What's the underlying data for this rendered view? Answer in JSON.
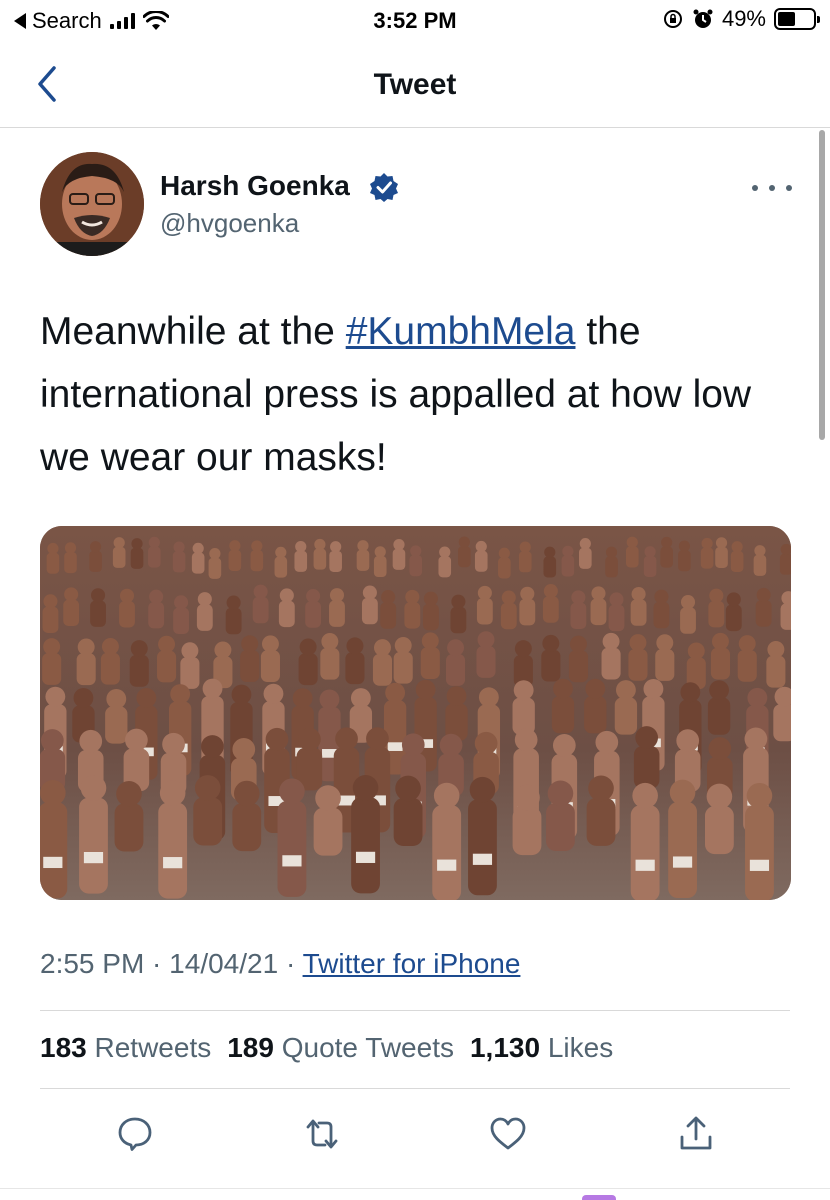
{
  "status_bar": {
    "back_app": "Search",
    "time": "3:52 PM",
    "battery": "49%",
    "battery_level": 0.49
  },
  "nav": {
    "title": "Tweet"
  },
  "tweet": {
    "author": {
      "name": "Harsh Goenka",
      "handle": "@hvgoenka",
      "verified": true
    },
    "text_before": "Meanwhile at the ",
    "hashtag": "#KumbhMela",
    "text_after": " the international press is appalled at how low we wear our masks!",
    "time": "2:55 PM",
    "date": "14/04/21",
    "separator": " · ",
    "source": "Twitter for iPhone",
    "stats": {
      "retweets_count": "183",
      "retweets_label": "Retweets",
      "quote_count": "189",
      "quote_label": "Quote Tweets",
      "likes_count": "1,130",
      "likes_label": "Likes"
    }
  },
  "actions": [
    "reply-icon",
    "retweet-icon",
    "like-icon",
    "share-icon"
  ],
  "colors": {
    "link": "#1d4b8f",
    "verified": "#1d4b8f",
    "secondary_text": "#536471",
    "icon": "#4a6178"
  }
}
